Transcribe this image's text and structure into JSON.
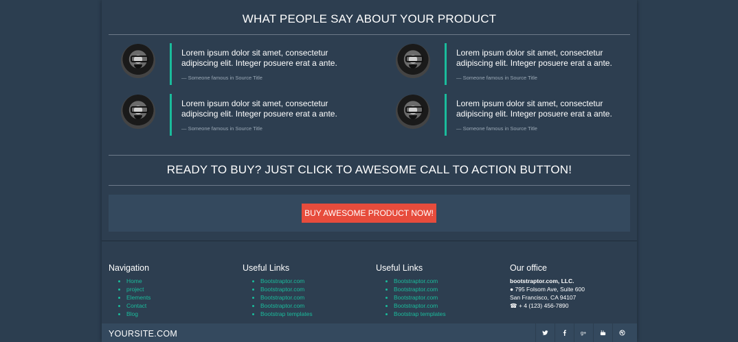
{
  "testimonials_section": {
    "title": "WHAT PEOPLE SAY ABOUT YOUR PRODUCT",
    "items": [
      {
        "quote": "Lorem ipsum dolor sit amet, consectetur adipiscing elit. Integer posuere erat a ante.",
        "source": "— Someone famous in Source Title"
      },
      {
        "quote": "Lorem ipsum dolor sit amet, consectetur adipiscing elit. Integer posuere erat a ante.",
        "source": "— Someone famous in Source Title"
      },
      {
        "quote": "Lorem ipsum dolor sit amet, consectetur adipiscing elit. Integer posuere erat a ante.",
        "source": "— Someone famous in Source Title"
      },
      {
        "quote": "Lorem ipsum dolor sit amet, consectetur adipiscing elit. Integer posuere erat a ante.",
        "source": "— Someone famous in Source Title"
      }
    ]
  },
  "cta_section": {
    "title": "READY TO BUY? JUST CLICK TO AWESOME CALL TO ACTION BUTTON!",
    "button_label": "BUY AWESOME PRODUCT NOW!"
  },
  "footer": {
    "navigation": {
      "heading": "Navigation",
      "links": [
        "Home",
        "project",
        "Elements",
        "Contact",
        "Blog"
      ]
    },
    "useful_links_1": {
      "heading": "Useful Links",
      "links": [
        "Bootstraptor.com",
        "Bootstraptor.com",
        "Bootstraptor.com",
        "Bootstraptor.com",
        "Bootstrap templates"
      ]
    },
    "useful_links_2": {
      "heading": "Useful Links",
      "links": [
        "Bootstraptor.com",
        "Bootstraptor.com",
        "Bootstraptor.com",
        "Bootstraptor.com",
        "Bootstrap templates"
      ]
    },
    "office": {
      "heading": "Our office",
      "company": "bootstraptor.com, LLC.",
      "address_line1": "795 Folsom Ave, Suite 600",
      "address_line2": "San Francisco, CA 94107",
      "phone": "+ 4 (123) 456-7890"
    }
  },
  "bottom_bar": {
    "site_name": "YOURSITE.COM",
    "social_icons": [
      "twitter-icon",
      "facebook-icon",
      "google-plus-icon",
      "youtube-icon",
      "dribbble-icon"
    ]
  },
  "colors": {
    "background": "#2c3e50",
    "panel": "#34495e",
    "accent": "#1abc9c",
    "cta": "#e74c3c"
  }
}
